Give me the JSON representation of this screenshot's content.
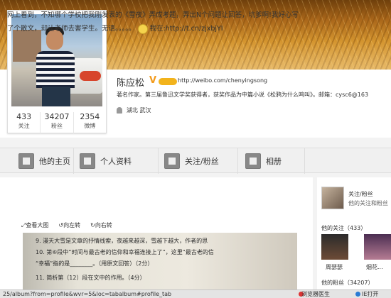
{
  "profile": {
    "name": "陈应松",
    "v_mark": "V",
    "weibo_url": "http://weibo.com/chenyingsong",
    "bio": "著名作家。第三届鲁迅文学奖获得者，获奖作品为中篇小说《松鸦为什么鸣叫》。邮箱：cysc6@163",
    "location": "湖北 武汉"
  },
  "stats": [
    {
      "value": "433",
      "label": "关注"
    },
    {
      "value": "34207",
      "label": "粉丝"
    },
    {
      "value": "2354",
      "label": "微博"
    }
  ],
  "tabs": {
    "home": "他的主页",
    "profile": "个人资料",
    "follow": "关注/粉丝",
    "album": "相册"
  },
  "post": {
    "text": "网上看到，不知哪个学校把我刚发表的《雪夜》弄成考题，弄出N个问题让回答，坑爹啊!我好心写了个散文，却让老师去害学生。无语。。。。。",
    "link_prefix": "我在:",
    "link": "http://t.cn/zjxbjYI"
  },
  "image_toolbar": {
    "zoom": "查看大图",
    "rotate_left": "向左转",
    "rotate_right": "向右转"
  },
  "exam_image": {
    "line1": "9. 漫天大雪是文章的抒情线索，夜越来越深，雪越下越大，作者的思",
    "line2": "10. 第⑥段中“时间与最古老的信仰和幸福连接上了”，这里“最古老的信",
    "line3": "“幸福”指的是________。（用原文回答）（2分）",
    "line4": "11. 简析第（12）段在文中的作用。（4分）"
  },
  "sidebar": {
    "card_title": "关注/粉丝",
    "card_sub": "他的关注和粉丝",
    "following_heading": "他的关注（433）",
    "friend1": "周瑟瑟",
    "friend2": "烟花...",
    "fans_heading": "他的粉丝（34207）"
  },
  "status_bar": {
    "url": "25/album?from=profile&wvr=5&loc=tabalbum#profile_tab",
    "doctor": "浏览器医生",
    "ie": "IE打开"
  }
}
